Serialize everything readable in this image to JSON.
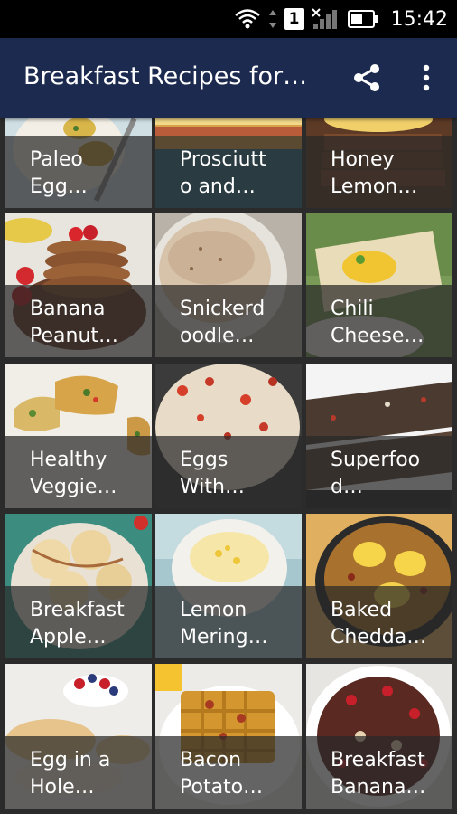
{
  "status_bar": {
    "time": "15:42",
    "sim_label": "1"
  },
  "app_bar": {
    "title": "Breakfast Recipes for…"
  },
  "recipes": [
    {
      "line1": "Paleo",
      "line2": "Egg…"
    },
    {
      "line1": "Prosciutt",
      "line2": "o and…"
    },
    {
      "line1": "Honey",
      "line2": "Lemon…"
    },
    {
      "line1": "Banana",
      "line2": "Peanut…"
    },
    {
      "line1": "Snickerd",
      "line2": "oodle…"
    },
    {
      "line1": "Chili",
      "line2": "Cheese…"
    },
    {
      "line1": "Healthy",
      "line2": "Veggie…"
    },
    {
      "line1": "Eggs",
      "line2": "With…"
    },
    {
      "line1": "Superfoo",
      "line2": "d…"
    },
    {
      "line1": "Breakfast",
      "line2": "Apple…"
    },
    {
      "line1": "Lemon",
      "line2": "Mering…"
    },
    {
      "line1": "Baked",
      "line2": "Chedda…"
    },
    {
      "line1": "Egg in a",
      "line2": "Hole…"
    },
    {
      "line1": "Bacon",
      "line2": "Potato…"
    },
    {
      "line1": "Breakfast",
      "line2": "Banana…"
    }
  ],
  "colors": {
    "app_bar": "#1b2a4e",
    "status_bar": "#000000",
    "caption_overlay": "#282828"
  }
}
